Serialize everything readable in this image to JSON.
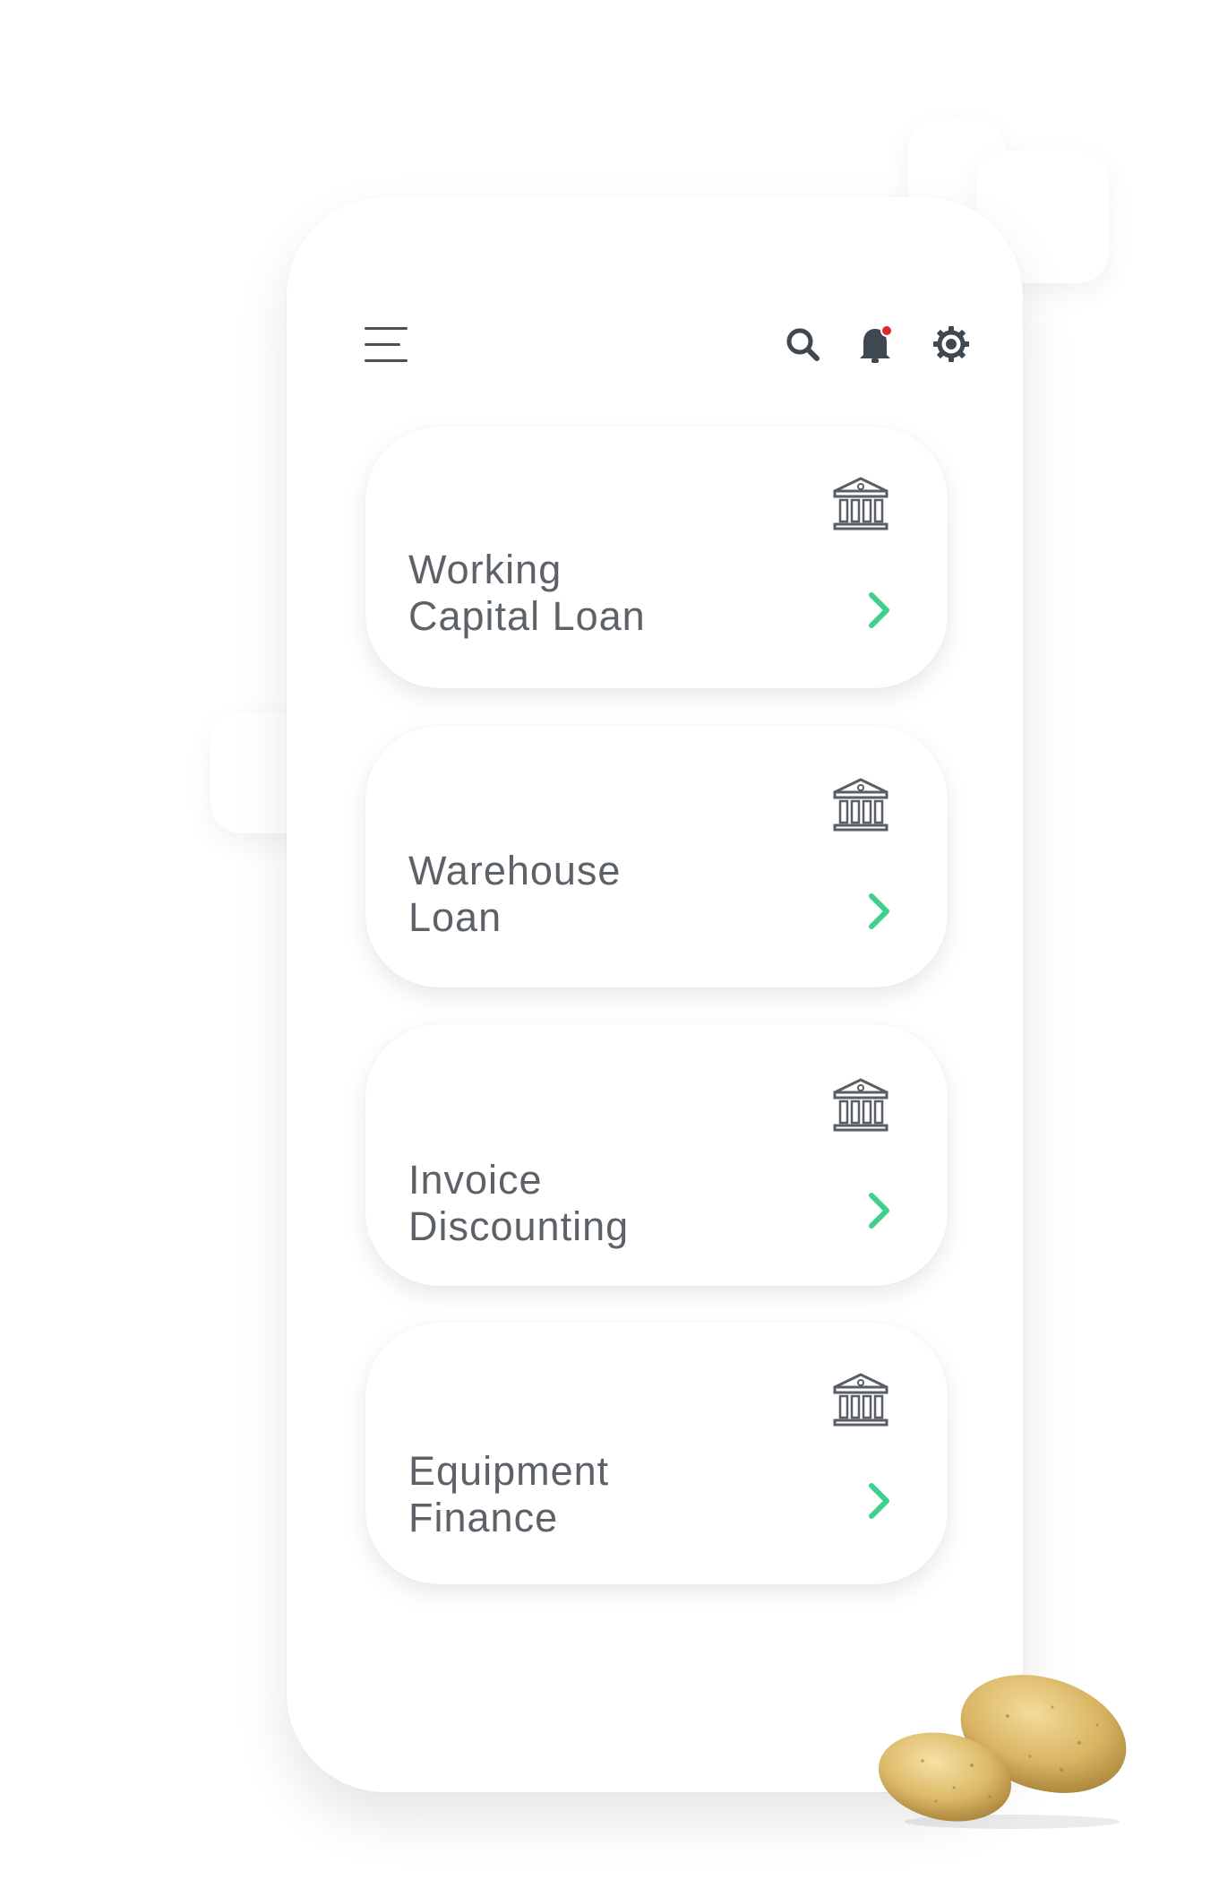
{
  "header": {
    "menu_icon": "hamburger-menu-icon",
    "search_icon": "search-icon",
    "notification_icon": "bell-icon",
    "settings_icon": "gear-icon",
    "notification_dot_color": "#e0252b",
    "icon_color": "#3f4750"
  },
  "loans": [
    {
      "line1": "Working",
      "line2": "Capital Loan",
      "icon": "bank-icon",
      "action_icon": "chevron-right-icon"
    },
    {
      "line1": "Warehouse",
      "line2": "Loan",
      "icon": "bank-icon",
      "action_icon": "chevron-right-icon"
    },
    {
      "line1": "Invoice",
      "line2": "Discounting",
      "icon": "bank-icon",
      "action_icon": "chevron-right-icon"
    },
    {
      "line1": "Equipment",
      "line2": "Finance",
      "icon": "bank-icon",
      "action_icon": "chevron-right-icon"
    }
  ],
  "colors": {
    "accent": "#3fd08f",
    "text": "#5d6268",
    "icon_gray": "#5a5f66"
  }
}
